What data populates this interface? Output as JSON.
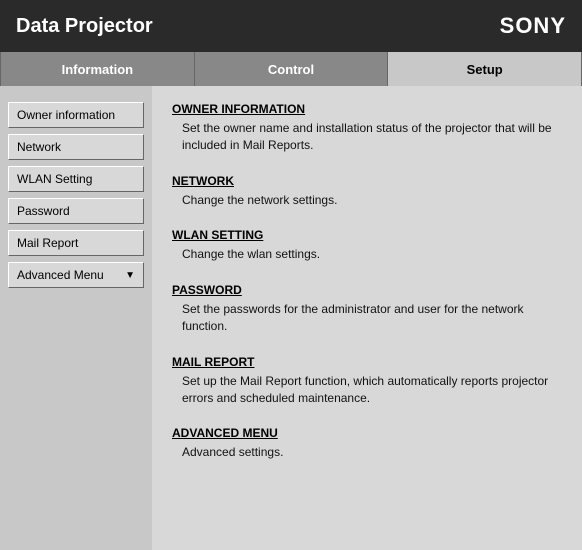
{
  "header": {
    "title": "Data Projector",
    "brand": "SONY"
  },
  "tabs": [
    {
      "label": "Information",
      "active": false
    },
    {
      "label": "Control",
      "active": false
    },
    {
      "label": "Setup",
      "active": true
    }
  ],
  "sidebar": {
    "buttons": [
      {
        "label": "Owner information",
        "id": "owner-information"
      },
      {
        "label": "Network",
        "id": "network"
      },
      {
        "label": "WLAN Setting",
        "id": "wlan-setting"
      },
      {
        "label": "Password",
        "id": "password"
      },
      {
        "label": "Mail Report",
        "id": "mail-report"
      }
    ],
    "advanced_label": "Advanced Menu",
    "advanced_chevron": "▼"
  },
  "content": {
    "sections": [
      {
        "title": "OWNER INFORMATION",
        "description": "Set the owner name and installation status of the projector that will be included in Mail Reports."
      },
      {
        "title": "NETWORK",
        "description": "Change the network settings."
      },
      {
        "title": "WLAN SETTING",
        "description": "Change the wlan settings."
      },
      {
        "title": "PASSWORD",
        "description": "Set the passwords for the administrator and user for the network function."
      },
      {
        "title": "MAIL REPORT",
        "description": "Set up the Mail Report function, which automatically reports projector errors and scheduled maintenance."
      },
      {
        "title": "ADVANCED MENU",
        "description": "Advanced settings."
      }
    ]
  }
}
